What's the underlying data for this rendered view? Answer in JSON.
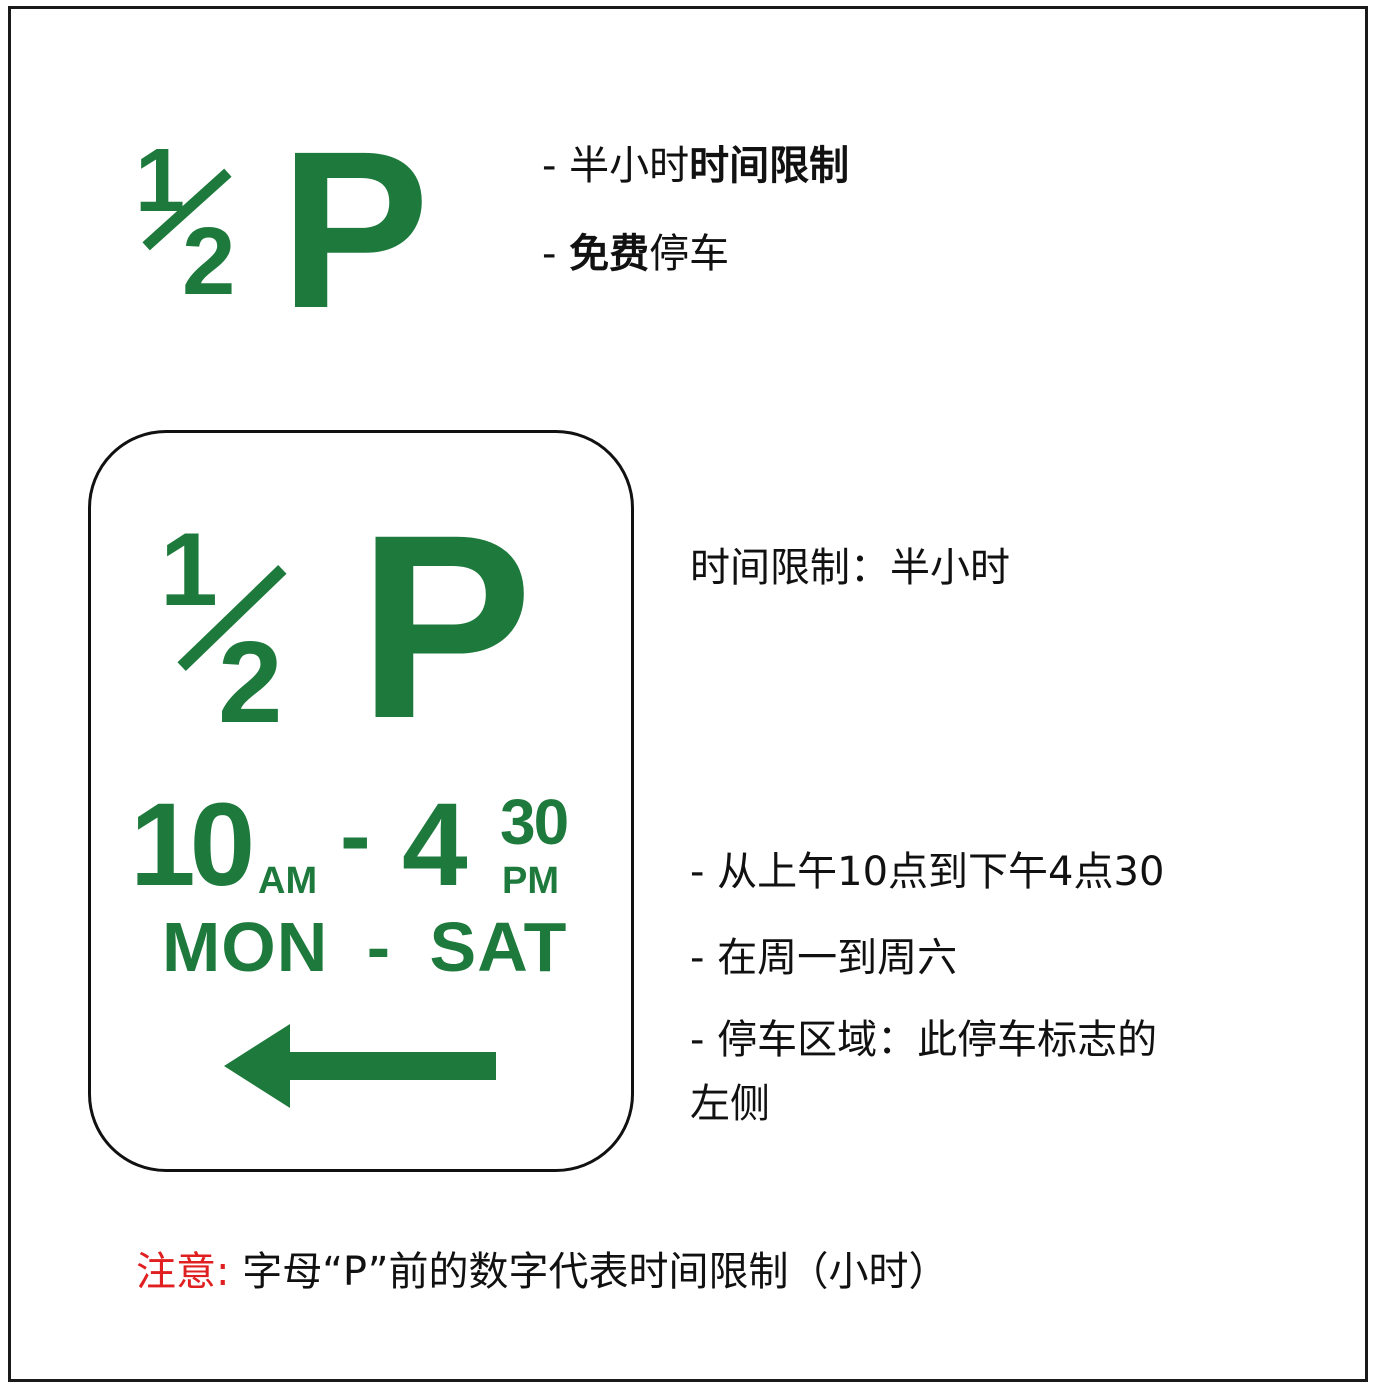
{
  "colors": {
    "sign_green": "#1e7a3c",
    "note_red": "#e02020",
    "text": "#111111",
    "border": "#1a1a1a"
  },
  "top_sign": {
    "numerator": "1",
    "denominator": "2",
    "letter": "P"
  },
  "top_desc": {
    "line1_prefix": "- 半小时",
    "line1_bold": "时间限制",
    "line2_prefix": "- ",
    "line2_bold": "免费",
    "line2_rest": "停车"
  },
  "bottom_sign": {
    "numerator": "1",
    "denominator": "2",
    "letter": "P",
    "start_hour": "10",
    "start_period": "AM",
    "dash": "-",
    "end_hour": "4",
    "end_minutes": "30",
    "end_period": "PM",
    "days": "MON - SAT",
    "arrow": "left-arrow-icon"
  },
  "bottom_desc": {
    "limit_line": "时间限制：半小时",
    "time_line": "- 从上午10点到下午4点30",
    "days_line": "- 在周一到周六",
    "zone_line1": "- 停车区域：此停车标志的",
    "zone_line2": "左侧"
  },
  "note": {
    "label": "注意:",
    "text": " 字母“P”前的数字代表时间限制（小时）"
  }
}
